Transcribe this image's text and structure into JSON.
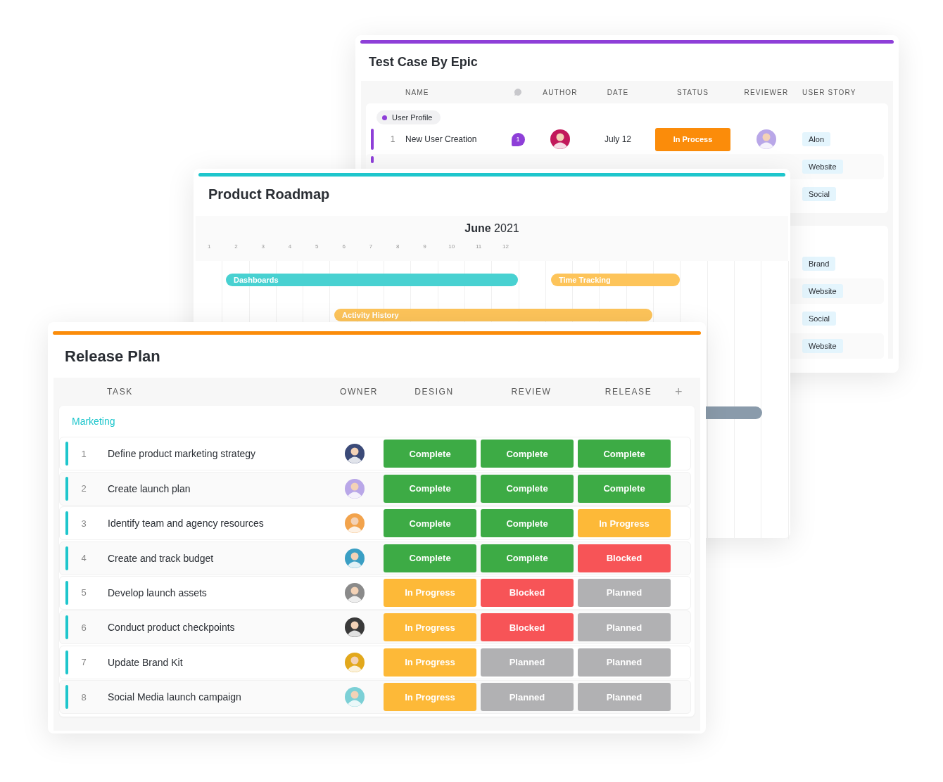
{
  "test_case": {
    "title": "Test Case By Epic",
    "columns": [
      "NAME",
      "AUTHOR",
      "DATE",
      "STATUS",
      "REVIEWER",
      "USER STORY"
    ],
    "groups": [
      {
        "name": "User Profile",
        "color": "#8e3fd8",
        "rows": [
          {
            "kind": "full",
            "number": "1",
            "name": "New User Creation",
            "comments": "1",
            "date": "July 12",
            "status": "In Process",
            "user_story": "Alon"
          },
          {
            "kind": "covered",
            "user_story": "Website"
          },
          {
            "kind": "tag",
            "user_story": "Social"
          }
        ]
      },
      {
        "rows": [
          {
            "kind": "tag",
            "user_story": "Brand"
          },
          {
            "kind": "tag",
            "user_story": "Website"
          },
          {
            "kind": "tag",
            "user_story": "Social"
          },
          {
            "kind": "tag",
            "user_story": "Website"
          }
        ]
      }
    ]
  },
  "roadmap": {
    "title": "Product Roadmap",
    "month": "June",
    "year": "2021",
    "days": [
      "1",
      "2",
      "3",
      "4",
      "5",
      "6",
      "7",
      "8",
      "9",
      "10",
      "11",
      "12"
    ],
    "bars": [
      {
        "label": "Dashboards",
        "color": "#48d1d1"
      },
      {
        "label": "Time Tracking",
        "color": "#fdc45a"
      },
      {
        "label": "Activity History",
        "color": "#fdc45a"
      },
      {
        "color": "#8a9bab"
      }
    ]
  },
  "release_plan": {
    "title": "Release Plan",
    "columns": [
      "TASK",
      "OWNER",
      "DESIGN",
      "REVIEW",
      "RELEASE"
    ],
    "add": "+",
    "group": {
      "name": "Marketing",
      "color": "#1ec6cc"
    },
    "rows": [
      {
        "number": "1",
        "task": "Define product marketing strategy",
        "stages": [
          {
            "kind": "complete",
            "label": "Complete"
          },
          {
            "kind": "complete",
            "label": "Complete"
          },
          {
            "kind": "complete",
            "label": "Complete"
          }
        ]
      },
      {
        "number": "2",
        "task": "Create launch plan",
        "stages": [
          {
            "kind": "complete",
            "label": "Complete"
          },
          {
            "kind": "complete",
            "label": "Complete"
          },
          {
            "kind": "complete",
            "label": "Complete"
          }
        ]
      },
      {
        "number": "3",
        "task": "Identify team and agency resources",
        "stages": [
          {
            "kind": "complete",
            "label": "Complete"
          },
          {
            "kind": "complete",
            "label": "Complete"
          },
          {
            "kind": "progress",
            "label": "In Progress"
          }
        ]
      },
      {
        "number": "4",
        "task": "Create and track budget",
        "stages": [
          {
            "kind": "complete",
            "label": "Complete"
          },
          {
            "kind": "complete",
            "label": "Complete"
          },
          {
            "kind": "blocked",
            "label": "Blocked"
          }
        ]
      },
      {
        "number": "5",
        "task": "Develop launch assets",
        "stages": [
          {
            "kind": "progress",
            "label": "In Progress"
          },
          {
            "kind": "blocked",
            "label": "Blocked"
          },
          {
            "kind": "planned",
            "label": "Planned"
          }
        ]
      },
      {
        "number": "6",
        "task": "Conduct product checkpoints",
        "stages": [
          {
            "kind": "progress",
            "label": "In Progress"
          },
          {
            "kind": "blocked",
            "label": "Blocked"
          },
          {
            "kind": "planned",
            "label": "Planned"
          }
        ]
      },
      {
        "number": "7",
        "task": "Update Brand Kit",
        "stages": [
          {
            "kind": "progress",
            "label": "In Progress"
          },
          {
            "kind": "planned",
            "label": "Planned"
          },
          {
            "kind": "planned",
            "label": "Planned"
          }
        ]
      },
      {
        "number": "8",
        "task": "Social Media launch campaign",
        "stages": [
          {
            "kind": "progress",
            "label": "In Progress"
          },
          {
            "kind": "planned",
            "label": "Planned"
          },
          {
            "kind": "planned",
            "label": "Planned"
          }
        ]
      }
    ]
  }
}
